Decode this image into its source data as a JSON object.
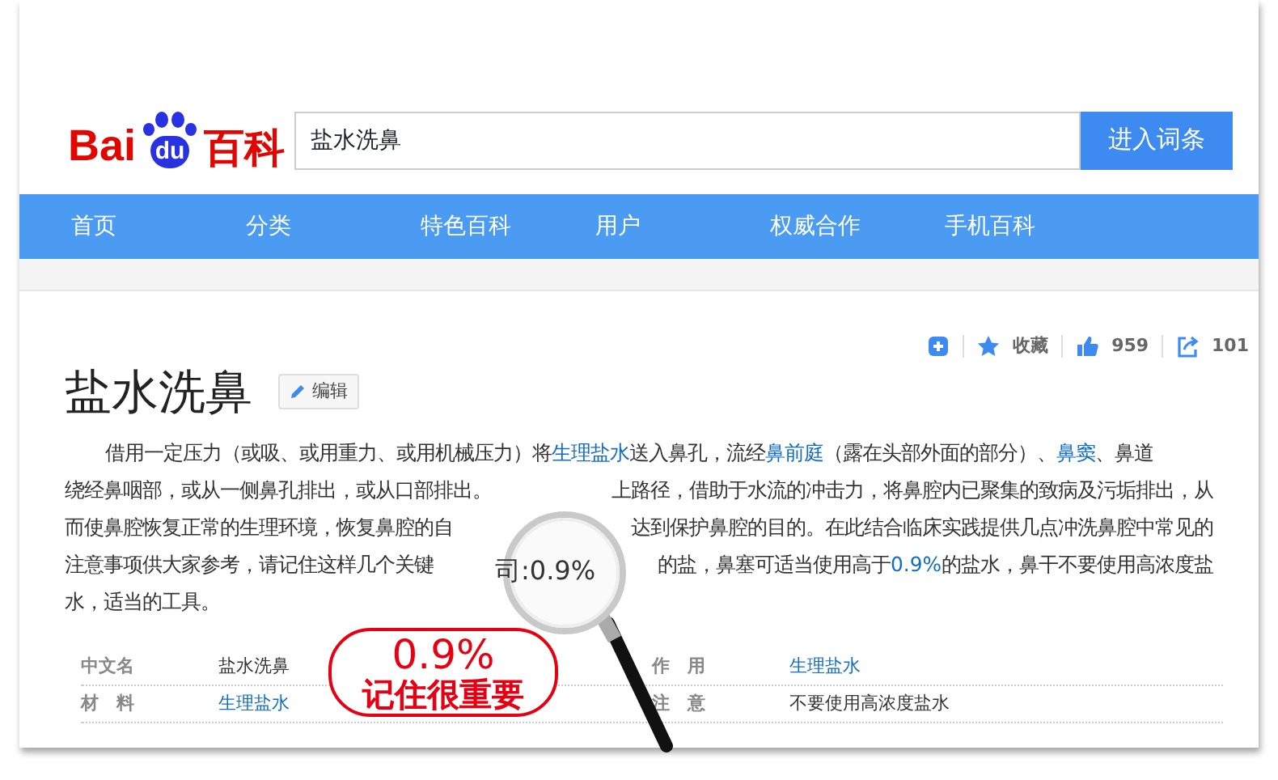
{
  "logo": {
    "left": "Bai",
    "badge": "du",
    "right": "百科"
  },
  "search": {
    "value": "盐水洗鼻",
    "button": "进入词条"
  },
  "nav": [
    {
      "label": "首页"
    },
    {
      "label": "分类"
    },
    {
      "label": "特色百科"
    },
    {
      "label": "用户"
    },
    {
      "label": "权威合作"
    },
    {
      "label": "手机百科"
    }
  ],
  "actions": [
    {
      "kind": "add"
    },
    {
      "kind": "star",
      "label": "收藏"
    },
    {
      "kind": "like",
      "label": "959"
    },
    {
      "kind": "share",
      "label": "101"
    }
  ],
  "title": "盐水洗鼻",
  "edit_button": "编辑",
  "paragraph_lines": [
    {
      "left": [
        {
          "text": "借用一定压力（或吸、或用重力、或用机械压力）将",
          "link": false
        },
        {
          "text": "生理盐水",
          "link": true
        },
        {
          "text": "送入鼻孔，流经",
          "link": false
        },
        {
          "text": "鼻前庭",
          "link": true
        },
        {
          "text": "（露在头部外面的部分）、",
          "link": false
        },
        {
          "text": "鼻窦",
          "link": true
        },
        {
          "text": "、鼻道",
          "link": false
        }
      ]
    },
    {
      "left": [
        {
          "text": "绕经鼻咽部，或从一侧鼻孔排出，或从口部排出。",
          "link": false
        }
      ],
      "right": [
        {
          "text": "上路径，借助于水流的冲击力，将鼻腔内已聚集的致病及污垢排出，从",
          "link": false
        }
      ]
    },
    {
      "left": [
        {
          "text": "而使鼻腔恢复正常的生理环境，恢复鼻腔的自",
          "link": false
        }
      ],
      "right": [
        {
          "text": "达到保护鼻腔的目的。在此结合临床实践提供几点冲洗鼻腔中常见的",
          "link": false
        }
      ]
    },
    {
      "left": [
        {
          "text": "注意事项供大家参考，请记住这样几个关键",
          "link": false
        }
      ],
      "right": [
        {
          "text": "的盐，鼻塞可适当使用高于",
          "link": false
        },
        {
          "text": "0.9%",
          "link": true
        },
        {
          "text": "的盐水，鼻干不要使用高浓度盐",
          "link": false
        }
      ]
    },
    {
      "left": [
        {
          "text": "水，适当的工具。",
          "link": false
        }
      ]
    }
  ],
  "magnifier": {
    "text": "司:0.9%"
  },
  "infobox": [
    [
      {
        "label": "中文名",
        "value": "盐水洗鼻",
        "link": false
      },
      {
        "label": "作　用",
        "value": "生理盐水",
        "link": true
      }
    ],
    [
      {
        "label": "材　料",
        "value": "生理盐水",
        "link": true
      },
      {
        "label": "注　意",
        "value": "不要使用高浓度盐水",
        "link": false
      }
    ]
  ],
  "callout": {
    "figure": "0.9%",
    "caption": "记住很重要"
  }
}
